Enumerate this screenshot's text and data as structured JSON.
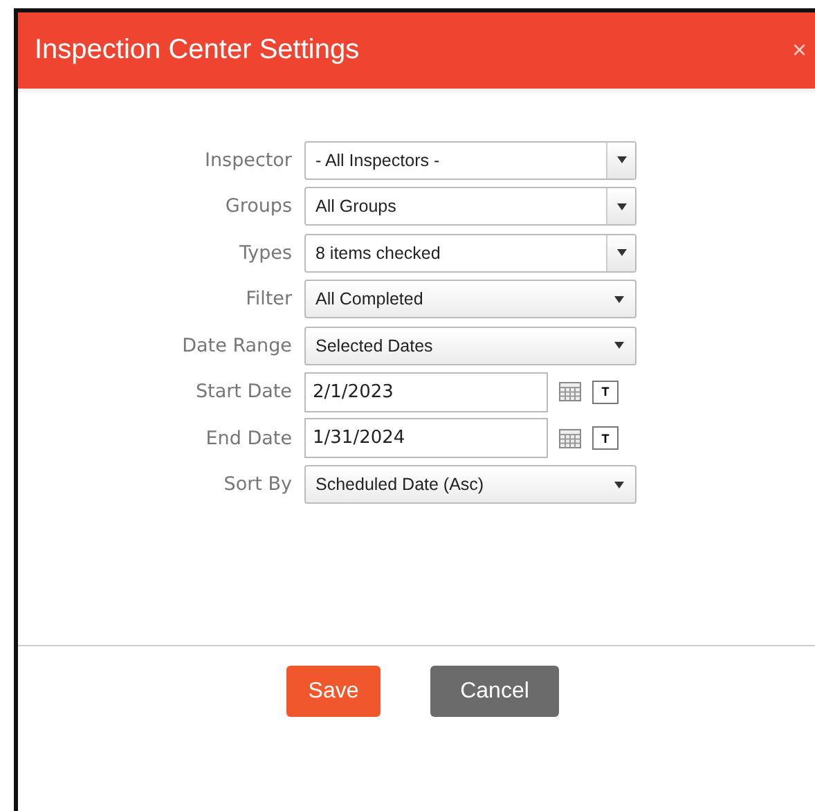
{
  "dialog": {
    "title": "Inspection Center Settings",
    "close_icon": "×"
  },
  "fields": [
    {
      "label": "Inspector",
      "kind": "combo",
      "value": "- All Inspectors -"
    },
    {
      "label": "Groups",
      "kind": "combo",
      "value": "All Groups"
    },
    {
      "label": "Types",
      "kind": "combo",
      "value": "8 items checked"
    },
    {
      "label": "Filter",
      "kind": "select",
      "value": "All Completed"
    },
    {
      "label": "Date Range",
      "kind": "select",
      "value": "Selected Dates"
    },
    {
      "label": "Start Date",
      "kind": "date",
      "value": "2/1/2023",
      "today_button": "T"
    },
    {
      "label": "End Date",
      "kind": "date",
      "value": "1/31/2024",
      "today_button": "T"
    },
    {
      "label": "Sort By",
      "kind": "select",
      "value": "Scheduled Date (Asc)"
    }
  ],
  "buttons": [
    {
      "label": "Save",
      "kind": "primary"
    },
    {
      "label": "Cancel",
      "kind": "secondary"
    }
  ]
}
